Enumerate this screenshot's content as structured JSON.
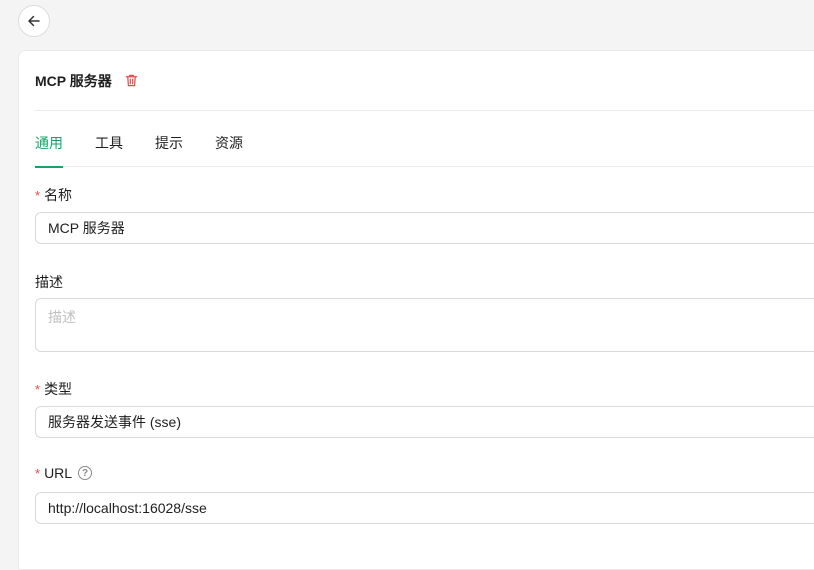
{
  "header": {
    "title": "MCP 服务器"
  },
  "tabs": [
    {
      "label": "通用"
    },
    {
      "label": "工具"
    },
    {
      "label": "提示"
    },
    {
      "label": "资源"
    }
  ],
  "form": {
    "name": {
      "label": "名称",
      "required_mark": "*",
      "value": "MCP 服务器"
    },
    "description": {
      "label": "描述",
      "placeholder": "描述",
      "value": ""
    },
    "type": {
      "label": "类型",
      "required_mark": "*",
      "value": "服务器发送事件 (sse)"
    },
    "url": {
      "label": "URL",
      "required_mark": "*",
      "help_glyph": "?",
      "value": "http://localhost:16028/sse"
    }
  },
  "colors": {
    "accent": "#16a36a",
    "danger": "#e5484d"
  },
  "icons": {
    "back": "arrow-left-icon",
    "delete": "trash-icon",
    "help": "question-circle-icon"
  }
}
